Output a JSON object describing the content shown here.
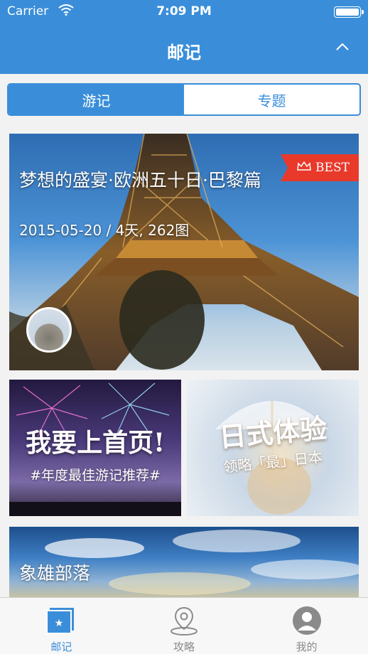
{
  "status_bar": {
    "carrier": "Carrier",
    "time": "7:09 PM"
  },
  "nav": {
    "title": "邮记"
  },
  "segment": {
    "tab1": "游记",
    "tab2": "专题"
  },
  "feed": {
    "main_card": {
      "title": "梦想的盛宴·欧洲五十日·巴黎篇",
      "meta": "2015-05-20 / 4天, 262图",
      "badge": "BEST"
    },
    "card_a": {
      "headline": "我要上首页!",
      "subline": "#年度最佳游记推荐#"
    },
    "card_b": {
      "headline": "日式体验",
      "subline": "领略「最」日本"
    },
    "card_c": {
      "title": "象雄部落"
    }
  },
  "tab_bar": {
    "items": [
      {
        "label": "邮记",
        "icon": "postcard-star-icon",
        "active": true
      },
      {
        "label": "攻略",
        "icon": "map-pin-icon",
        "active": false
      },
      {
        "label": "我的",
        "icon": "user-avatar-icon",
        "active": false
      }
    ]
  },
  "colors": {
    "brand": "#3a8ed9",
    "badge": "#e8392b"
  }
}
